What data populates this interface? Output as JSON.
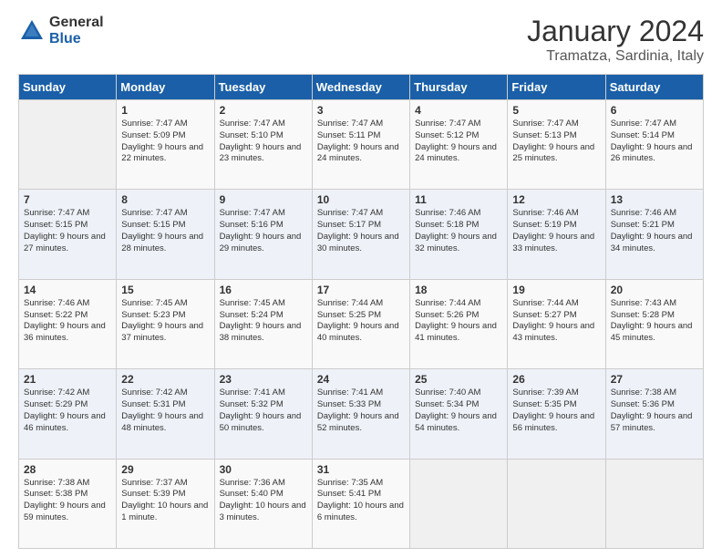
{
  "logo": {
    "general": "General",
    "blue": "Blue"
  },
  "title": "January 2024",
  "location": "Tramatza, Sardinia, Italy",
  "weekdays": [
    "Sunday",
    "Monday",
    "Tuesday",
    "Wednesday",
    "Thursday",
    "Friday",
    "Saturday"
  ],
  "weeks": [
    [
      {
        "day": "",
        "info": ""
      },
      {
        "day": "1",
        "info": "Sunrise: 7:47 AM\nSunset: 5:09 PM\nDaylight: 9 hours and 22 minutes."
      },
      {
        "day": "2",
        "info": "Sunrise: 7:47 AM\nSunset: 5:10 PM\nDaylight: 9 hours and 23 minutes."
      },
      {
        "day": "3",
        "info": "Sunrise: 7:47 AM\nSunset: 5:11 PM\nDaylight: 9 hours and 24 minutes."
      },
      {
        "day": "4",
        "info": "Sunrise: 7:47 AM\nSunset: 5:12 PM\nDaylight: 9 hours and 24 minutes."
      },
      {
        "day": "5",
        "info": "Sunrise: 7:47 AM\nSunset: 5:13 PM\nDaylight: 9 hours and 25 minutes."
      },
      {
        "day": "6",
        "info": "Sunrise: 7:47 AM\nSunset: 5:14 PM\nDaylight: 9 hours and 26 minutes."
      }
    ],
    [
      {
        "day": "7",
        "info": "Sunrise: 7:47 AM\nSunset: 5:15 PM\nDaylight: 9 hours and 27 minutes."
      },
      {
        "day": "8",
        "info": "Sunrise: 7:47 AM\nSunset: 5:15 PM\nDaylight: 9 hours and 28 minutes."
      },
      {
        "day": "9",
        "info": "Sunrise: 7:47 AM\nSunset: 5:16 PM\nDaylight: 9 hours and 29 minutes."
      },
      {
        "day": "10",
        "info": "Sunrise: 7:47 AM\nSunset: 5:17 PM\nDaylight: 9 hours and 30 minutes."
      },
      {
        "day": "11",
        "info": "Sunrise: 7:46 AM\nSunset: 5:18 PM\nDaylight: 9 hours and 32 minutes."
      },
      {
        "day": "12",
        "info": "Sunrise: 7:46 AM\nSunset: 5:19 PM\nDaylight: 9 hours and 33 minutes."
      },
      {
        "day": "13",
        "info": "Sunrise: 7:46 AM\nSunset: 5:21 PM\nDaylight: 9 hours and 34 minutes."
      }
    ],
    [
      {
        "day": "14",
        "info": "Sunrise: 7:46 AM\nSunset: 5:22 PM\nDaylight: 9 hours and 36 minutes."
      },
      {
        "day": "15",
        "info": "Sunrise: 7:45 AM\nSunset: 5:23 PM\nDaylight: 9 hours and 37 minutes."
      },
      {
        "day": "16",
        "info": "Sunrise: 7:45 AM\nSunset: 5:24 PM\nDaylight: 9 hours and 38 minutes."
      },
      {
        "day": "17",
        "info": "Sunrise: 7:44 AM\nSunset: 5:25 PM\nDaylight: 9 hours and 40 minutes."
      },
      {
        "day": "18",
        "info": "Sunrise: 7:44 AM\nSunset: 5:26 PM\nDaylight: 9 hours and 41 minutes."
      },
      {
        "day": "19",
        "info": "Sunrise: 7:44 AM\nSunset: 5:27 PM\nDaylight: 9 hours and 43 minutes."
      },
      {
        "day": "20",
        "info": "Sunrise: 7:43 AM\nSunset: 5:28 PM\nDaylight: 9 hours and 45 minutes."
      }
    ],
    [
      {
        "day": "21",
        "info": "Sunrise: 7:42 AM\nSunset: 5:29 PM\nDaylight: 9 hours and 46 minutes."
      },
      {
        "day": "22",
        "info": "Sunrise: 7:42 AM\nSunset: 5:31 PM\nDaylight: 9 hours and 48 minutes."
      },
      {
        "day": "23",
        "info": "Sunrise: 7:41 AM\nSunset: 5:32 PM\nDaylight: 9 hours and 50 minutes."
      },
      {
        "day": "24",
        "info": "Sunrise: 7:41 AM\nSunset: 5:33 PM\nDaylight: 9 hours and 52 minutes."
      },
      {
        "day": "25",
        "info": "Sunrise: 7:40 AM\nSunset: 5:34 PM\nDaylight: 9 hours and 54 minutes."
      },
      {
        "day": "26",
        "info": "Sunrise: 7:39 AM\nSunset: 5:35 PM\nDaylight: 9 hours and 56 minutes."
      },
      {
        "day": "27",
        "info": "Sunrise: 7:38 AM\nSunset: 5:36 PM\nDaylight: 9 hours and 57 minutes."
      }
    ],
    [
      {
        "day": "28",
        "info": "Sunrise: 7:38 AM\nSunset: 5:38 PM\nDaylight: 9 hours and 59 minutes."
      },
      {
        "day": "29",
        "info": "Sunrise: 7:37 AM\nSunset: 5:39 PM\nDaylight: 10 hours and 1 minute."
      },
      {
        "day": "30",
        "info": "Sunrise: 7:36 AM\nSunset: 5:40 PM\nDaylight: 10 hours and 3 minutes."
      },
      {
        "day": "31",
        "info": "Sunrise: 7:35 AM\nSunset: 5:41 PM\nDaylight: 10 hours and 6 minutes."
      },
      {
        "day": "",
        "info": ""
      },
      {
        "day": "",
        "info": ""
      },
      {
        "day": "",
        "info": ""
      }
    ]
  ]
}
